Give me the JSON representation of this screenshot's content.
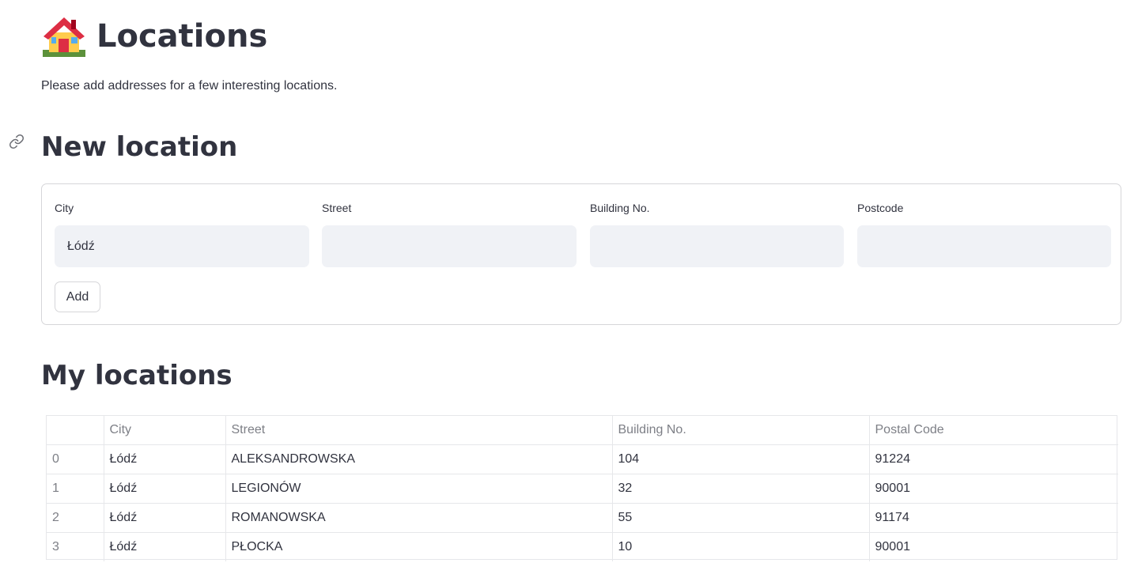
{
  "page": {
    "title": "Locations",
    "title_icon": "house-with-garden-emoji",
    "intro": "Please add addresses for a few interesting locations."
  },
  "new_location": {
    "heading": "New location",
    "anchor_icon": "link-icon",
    "fields": [
      {
        "label": "City",
        "value": "Łódź"
      },
      {
        "label": "Street",
        "value": ""
      },
      {
        "label": "Building No.",
        "value": ""
      },
      {
        "label": "Postcode",
        "value": ""
      }
    ],
    "add_label": "Add"
  },
  "my_locations": {
    "heading": "My locations",
    "table": {
      "headers": [
        "",
        "City",
        "Street",
        "Building No.",
        "Postal Code"
      ],
      "rows": [
        [
          "0",
          "Łódź",
          "ALEKSANDROWSKA",
          "104",
          "91224"
        ],
        [
          "1",
          "Łódź",
          "LEGIONÓW",
          "32",
          "90001"
        ],
        [
          "2",
          "Łódź",
          "ROMANOWSKA",
          "55",
          "91174"
        ],
        [
          "3",
          "Łódź",
          "PŁOCKA",
          "10",
          "90001"
        ]
      ]
    }
  },
  "colors": {
    "text": "#31333f",
    "muted": "#7d7f86",
    "input_bg": "#f0f2f6",
    "border": "#d6d6d9"
  }
}
